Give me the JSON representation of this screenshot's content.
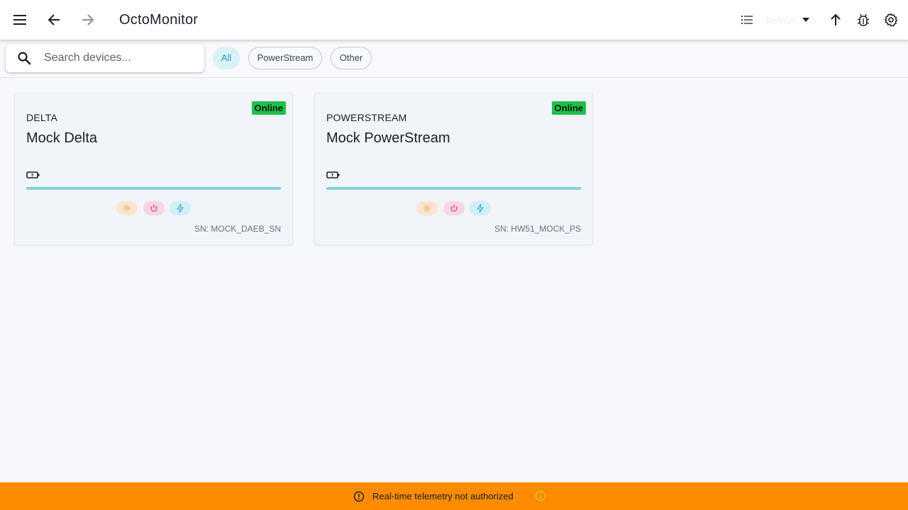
{
  "app": {
    "title": "OctoMonitor",
    "layout_select_value": "Default"
  },
  "search": {
    "placeholder": "Search devices..."
  },
  "filters": [
    {
      "label": "All",
      "active": true
    },
    {
      "label": "PowerStream",
      "active": false
    },
    {
      "label": "Other",
      "active": false
    }
  ],
  "devices": [
    {
      "type": "DELTA",
      "name": "Mock Delta",
      "status": "Online",
      "battery_level": 1.0,
      "serial": "SN: MOCK_DAEB_SN"
    },
    {
      "type": "POWERSTREAM",
      "name": "Mock PowerStream",
      "status": "Online",
      "battery_level": 1.0,
      "serial": "SN: HW51_MOCK_PS"
    }
  ],
  "banner": {
    "message": "Real-time telemetry not authorized"
  },
  "colors": {
    "accent": "#1aa3c1",
    "online": "#1fc04a",
    "banner": "#ff8c00",
    "solar": "#f4a04a",
    "power": "#e0457b",
    "bolt": "#2bb6d1"
  },
  "icons": {
    "menu": "menu-icon",
    "back": "arrow-back-icon",
    "forward": "arrow-forward-icon",
    "view": "list-icon",
    "dropdown": "caret-down-icon",
    "upload": "arrow-up-icon",
    "debug": "bug-icon",
    "settings": "gear-icon",
    "search": "search-icon",
    "battery": "battery-icon",
    "solar": "sun-icon",
    "power": "power-icon",
    "bolt": "bolt-icon",
    "warning": "alert-circle-icon",
    "info": "info-icon"
  }
}
